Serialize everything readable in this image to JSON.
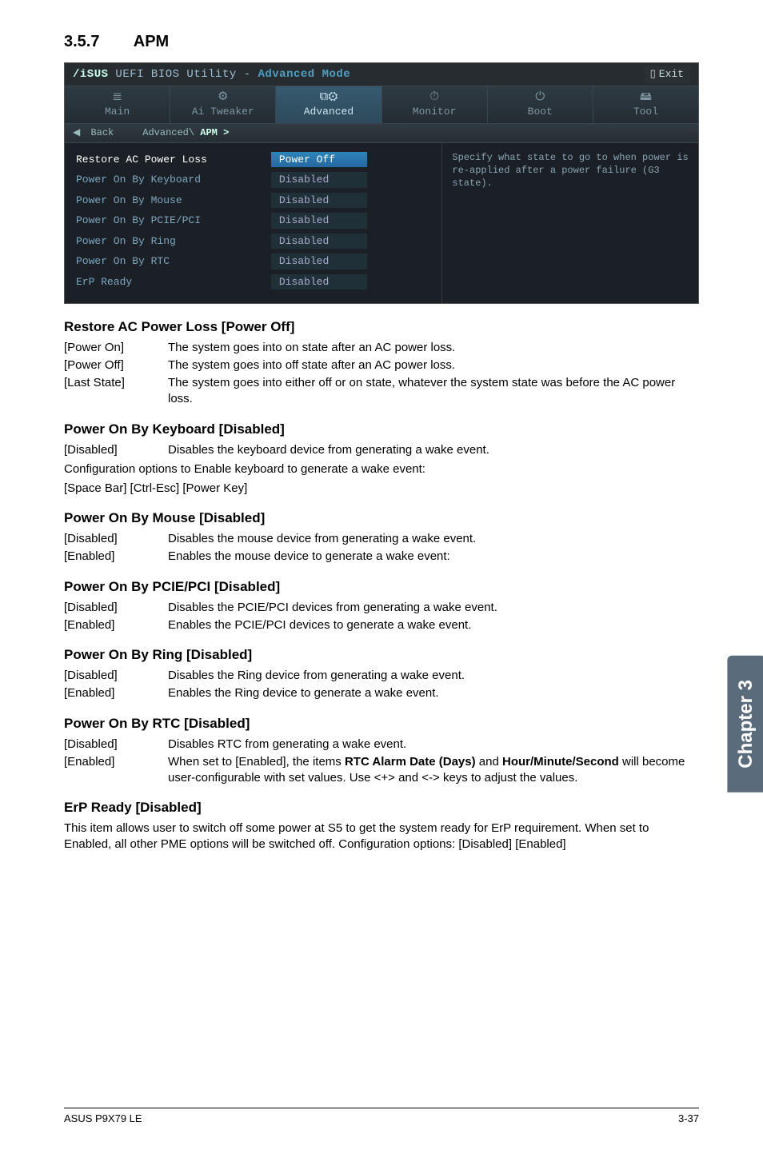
{
  "section": {
    "number": "3.5.7",
    "title": "APM"
  },
  "bios": {
    "brand_logo": "/iSUS",
    "brand_sub1": "UEFI BIOS Utility -",
    "brand_sub2": "Advanced Mode",
    "exit_label": "Exit",
    "breadcrumb_back": "Back",
    "breadcrumb_path1": "Advanced\\",
    "breadcrumb_path2": "APM >",
    "tabs": [
      {
        "icon": "≣",
        "label": "Main"
      },
      {
        "icon": "⚙",
        "label": "Ai Tweaker"
      },
      {
        "icon": "⧉⚙",
        "label": "Advanced"
      },
      {
        "icon": "⏱",
        "label": "Monitor"
      },
      {
        "icon": "⏻",
        "label": "Boot"
      },
      {
        "icon": "🖴",
        "label": "Tool"
      }
    ],
    "settings": [
      {
        "name": "Restore AC Power Loss",
        "value": "Power Off",
        "active": "1"
      },
      {
        "name": "Power On By Keyboard",
        "value": "Disabled"
      },
      {
        "name": "Power On By Mouse",
        "value": "Disabled"
      },
      {
        "name": "Power On By PCIE/PCI",
        "value": "Disabled"
      },
      {
        "name": "Power On By Ring",
        "value": "Disabled"
      },
      {
        "name": "Power On By RTC",
        "value": "Disabled"
      },
      {
        "name": "ErP Ready",
        "value": "Disabled"
      }
    ],
    "help_text": "Specify what state to go to when power is re-applied after a power failure (G3 state)."
  },
  "body": {
    "restore_title": "Restore AC Power Loss [Power Off]",
    "restore_opts": [
      {
        "opt": "[Power On]",
        "desc": "The system goes into on state after an AC power loss."
      },
      {
        "opt": "[Power Off]",
        "desc": "The system goes into off state after an AC power loss."
      },
      {
        "opt": "[Last State]",
        "desc": "The system goes into either off or on state, whatever the system state was before the AC power loss."
      }
    ],
    "kb_title": "Power On By Keyboard [Disabled]",
    "kb_opt": "[Disabled]",
    "kb_desc": "Disables the keyboard device from generating a wake event.",
    "kb_para1": "Configuration options to Enable keyboard to generate a wake event:",
    "kb_para2": "[Space Bar] [Ctrl-Esc] [Power Key]",
    "mouse_title": "Power On By Mouse [Disabled]",
    "mouse_opts": [
      {
        "opt": "[Disabled]",
        "desc": "Disables the mouse device from generating a wake event."
      },
      {
        "opt": "[Enabled]",
        "desc": "Enables the mouse device to generate a wake event:"
      }
    ],
    "pcie_title": "Power On By PCIE/PCI [Disabled]",
    "pcie_opts": [
      {
        "opt": "[Disabled]",
        "desc": "Disables the PCIE/PCI devices from generating a wake event."
      },
      {
        "opt": "[Enabled]",
        "desc": "Enables the PCIE/PCI devices to generate a wake event."
      }
    ],
    "ring_title": "Power On By Ring [Disabled]",
    "ring_opts": [
      {
        "opt": "[Disabled]",
        "desc": "Disables the Ring device from generating a wake event."
      },
      {
        "opt": "[Enabled]",
        "desc": "Enables the Ring device to generate a wake event."
      }
    ],
    "rtc_title": "Power On By RTC [Disabled]",
    "rtc_opt1": "[Disabled]",
    "rtc_desc1": "Disables RTC from generating a wake event.",
    "rtc_opt2": "[Enabled]",
    "rtc_desc2a": "When set to [Enabled], the items ",
    "rtc_desc2b": "RTC Alarm Date (Days)",
    "rtc_desc2c": " and ",
    "rtc_desc2d": "Hour/Minute/Second",
    "rtc_desc2e": " will become user-configurable with set values. Use <+> and <-> keys to adjust the values.",
    "erp_title": "ErP Ready [Disabled]",
    "erp_para": "This item allows user to switch off some power at S5 to get the system ready for ErP requirement. When set to Enabled, all other PME options will be switched off. Configuration options: [Disabled] [Enabled]"
  },
  "sidetab": "Chapter 3",
  "footer": {
    "left": "ASUS P9X79 LE",
    "right": "3-37"
  }
}
